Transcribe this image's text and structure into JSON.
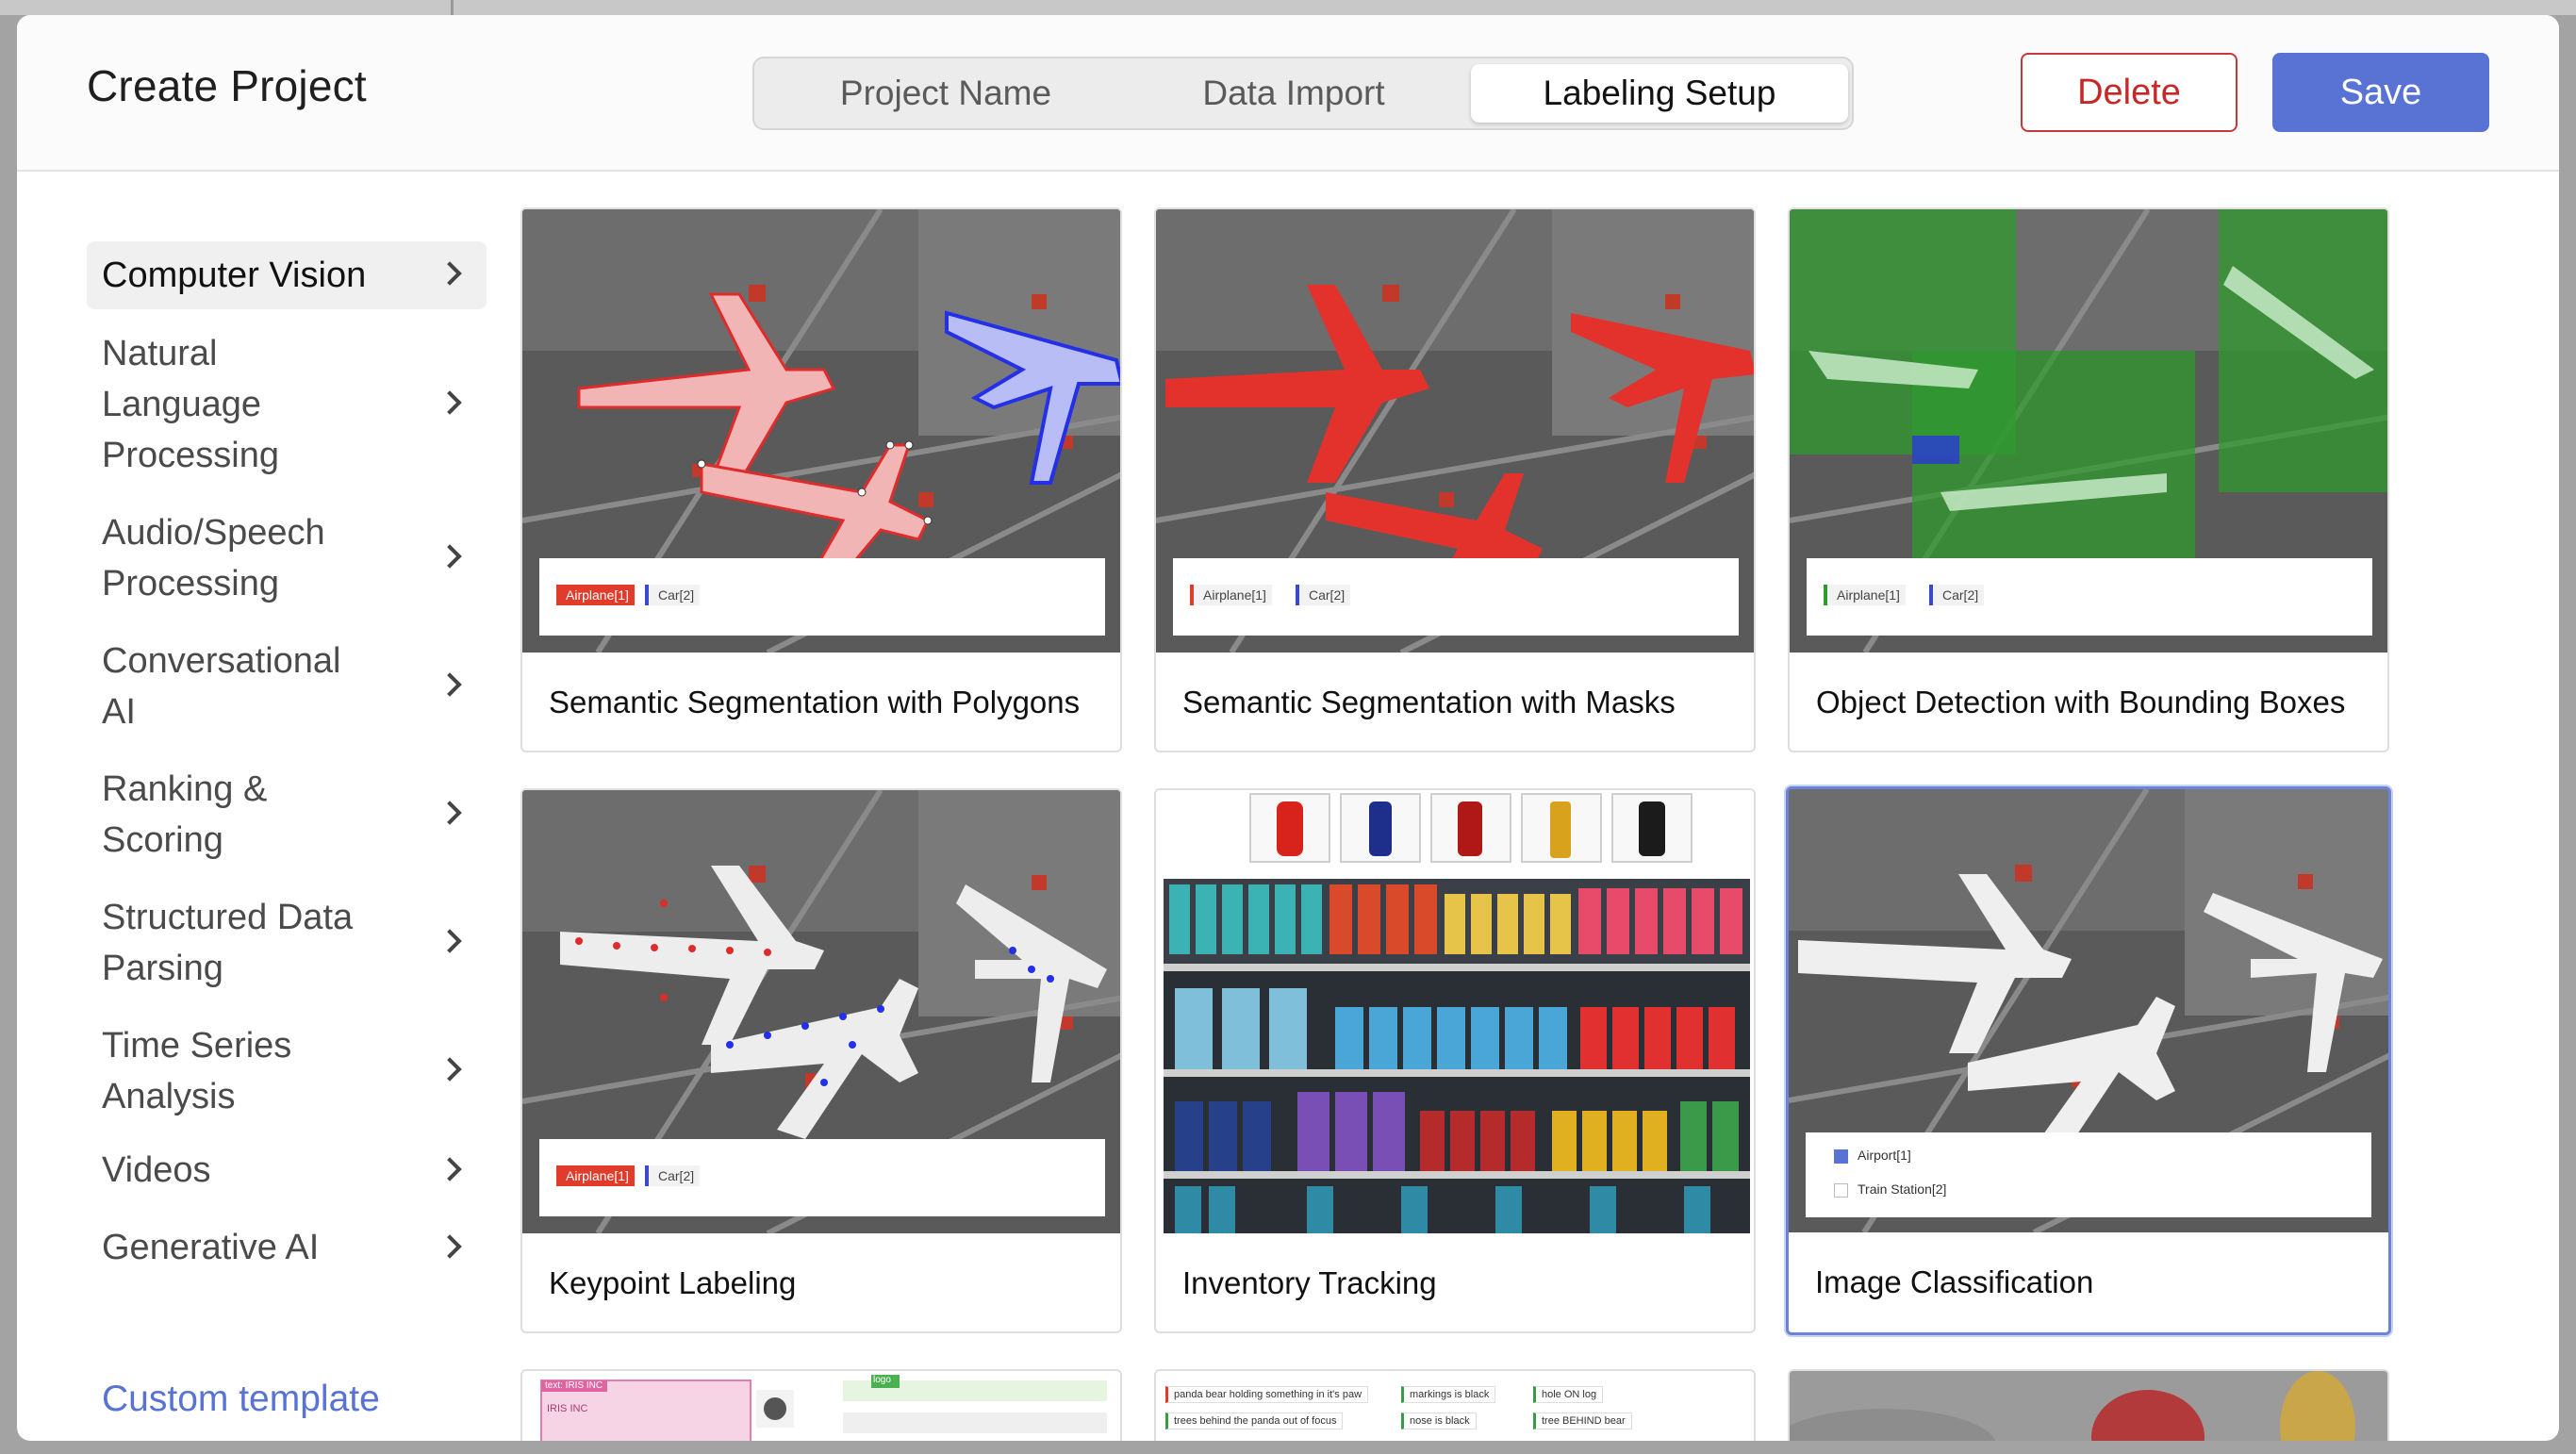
{
  "header": {
    "title": "Create Project",
    "steps": [
      "Project Name",
      "Data Import",
      "Labeling Setup"
    ],
    "active_step": "Labeling Setup",
    "delete_label": "Delete",
    "save_label": "Save"
  },
  "sidebar": {
    "items": [
      {
        "label": "Computer Vision",
        "active": true
      },
      {
        "label": "Natural Language Processing"
      },
      {
        "label": "Audio/Speech Processing"
      },
      {
        "label": "Conversational AI"
      },
      {
        "label": "Ranking & Scoring"
      },
      {
        "label": "Structured Data Parsing"
      },
      {
        "label": "Time Series Analysis"
      },
      {
        "label": "Videos"
      },
      {
        "label": "Generative AI"
      }
    ],
    "custom_template_label": "Custom template"
  },
  "templates": [
    {
      "title": "Semantic Segmentation with Polygons",
      "tags": [
        "Airplane[1]",
        "Car[2]"
      ]
    },
    {
      "title": "Semantic Segmentation with Masks",
      "tags": [
        "Airplane[1]",
        "Car[2]"
      ]
    },
    {
      "title": "Object Detection with Bounding Boxes",
      "tags": [
        "Airplane[1]",
        "Car[2]"
      ]
    },
    {
      "title": "Keypoint Labeling",
      "tags": [
        "Airplane[1]",
        "Car[2]"
      ]
    },
    {
      "title": "Inventory Tracking"
    },
    {
      "title": "Image Classification",
      "selected": true,
      "choices": [
        "Airport[1]",
        "Train Station[2]"
      ]
    }
  ],
  "partial_row": {
    "ocr_tags": [
      "text: IRIS INC",
      "logo"
    ],
    "ocr_text": "IRIS INC",
    "relation_tags": [
      "panda bear holding something in it's paw",
      "markings is black",
      "hole ON log",
      "trees behind the panda out of focus",
      "nose is black",
      "tree BEHIND bear"
    ]
  },
  "colors": {
    "accent": "#5873d3",
    "danger": "#c62828",
    "tag_red": "#e13b2b"
  }
}
